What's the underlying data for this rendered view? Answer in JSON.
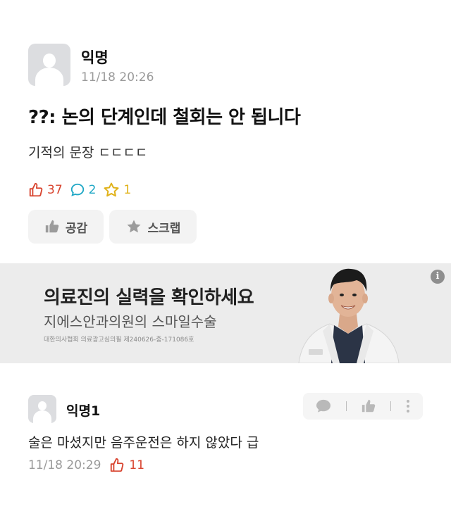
{
  "post": {
    "author": "익명",
    "time": "11/18 20:26",
    "title": "??: 논의 단계인데 철회는 안 됩니다",
    "body": "기적의 문장 ㄷㄷㄷㄷ",
    "stats": {
      "likes": "37",
      "comments": "2",
      "scraps": "1"
    },
    "buttons": {
      "like_label": "공감",
      "scrap_label": "스크랩"
    }
  },
  "ad": {
    "title": "의료진의 실력을 확인하세요",
    "subtitle": "지에스안과의원의 스마일수술",
    "disclaimer": "대한의사협회 의료광고심의필 제240626-중-171086호",
    "info_glyph": "i"
  },
  "comment": {
    "author": "익명1",
    "text": "술은 마셨지만 음주운전은 하지 않았다 급",
    "time": "11/18 20:29",
    "likes": "11"
  },
  "colors": {
    "like": "#d8432e",
    "comment": "#1ea7c5",
    "scrap": "#e0b21a",
    "button_bg": "#f3f3f3",
    "ad_bg": "#ececec"
  },
  "icons": [
    "thumbs-up-outline-icon",
    "speech-bubble-icon",
    "star-outline-icon",
    "thumbs-up-filled-icon",
    "star-filled-icon",
    "info-icon",
    "chat-filled-icon",
    "more-vertical-icon"
  ]
}
